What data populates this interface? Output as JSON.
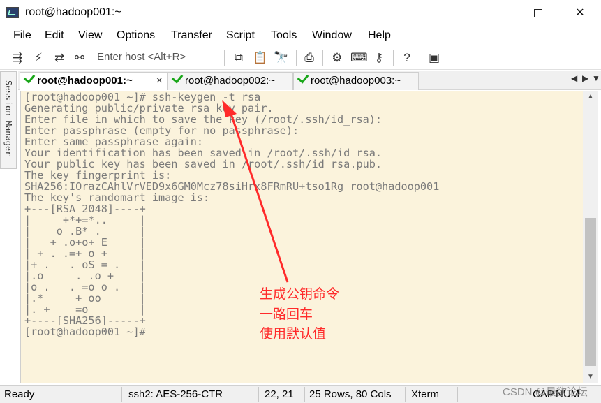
{
  "window": {
    "title": "root@hadoop001:~"
  },
  "menu": [
    "File",
    "Edit",
    "View",
    "Options",
    "Transfer",
    "Script",
    "Tools",
    "Window",
    "Help"
  ],
  "toolbar": {
    "host_placeholder": "Enter host <Alt+R>"
  },
  "session_manager": "Session Manager",
  "tabs": [
    {
      "label": "root@hadoop001:~",
      "active": true
    },
    {
      "label": "root@hadoop002:~",
      "active": false
    },
    {
      "label": "root@hadoop003:~",
      "active": false
    }
  ],
  "terminal": {
    "lines": [
      "[root@hadoop001 ~]# ssh-keygen -t rsa",
      "Generating public/private rsa key pair.",
      "Enter file in which to save the key (/root/.ssh/id_rsa):",
      "Enter passphrase (empty for no passphrase):",
      "Enter same passphrase again:",
      "Your identification has been saved in /root/.ssh/id_rsa.",
      "Your public key has been saved in /root/.ssh/id_rsa.pub.",
      "The key fingerprint is:",
      "SHA256:IOrazCAhlVrVED9x6GM0Mcz78siHrx8FRmRU+tso1Rg root@hadoop001",
      "The key's randomart image is:",
      "+---[RSA 2048]----+",
      "|     +*+=*..     |",
      "|    o .B* .      |",
      "|   + .o+o+ E     |",
      "| + . .=+ o +     |",
      "|+ .   . oS = .   |",
      "|.o     . .o +    |",
      "|o .   . =o o .   |",
      "|.*     + oo      |",
      "|. +    =o        |",
      "+----[SHA256]-----+",
      "[root@hadoop001 ~]#"
    ]
  },
  "annotation": {
    "color": "#ff2a2a",
    "lines": [
      "生成公钥命令",
      "一路回车",
      "使用默认值"
    ]
  },
  "status": {
    "ready": "Ready",
    "cipher": "ssh2: AES-256-CTR",
    "cursor": "22,  21",
    "size": "25 Rows, 80 Cols",
    "term": "Xterm",
    "caps": "CAP",
    "num": "NUM"
  },
  "watermark": "CSDN @最欲论坛"
}
